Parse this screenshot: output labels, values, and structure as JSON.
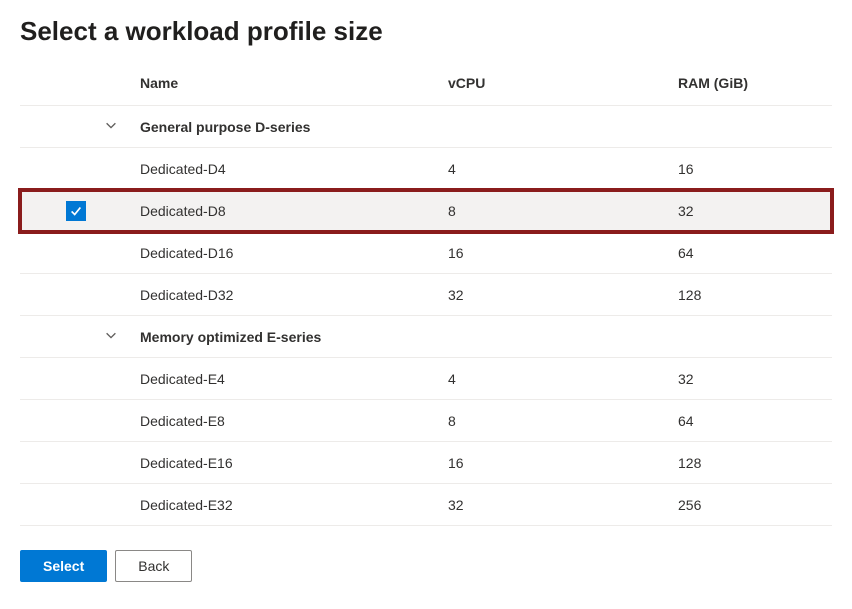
{
  "title": "Select a workload profile size",
  "columns": {
    "name": "Name",
    "vcpu": "vCPU",
    "ram": "RAM (GiB)"
  },
  "groups": [
    {
      "label": "General purpose D-series",
      "rows": [
        {
          "name": "Dedicated-D4",
          "vcpu": "4",
          "ram": "16",
          "selected": false
        },
        {
          "name": "Dedicated-D8",
          "vcpu": "8",
          "ram": "32",
          "selected": true
        },
        {
          "name": "Dedicated-D16",
          "vcpu": "16",
          "ram": "64",
          "selected": false
        },
        {
          "name": "Dedicated-D32",
          "vcpu": "32",
          "ram": "128",
          "selected": false
        }
      ]
    },
    {
      "label": "Memory optimized E-series",
      "rows": [
        {
          "name": "Dedicated-E4",
          "vcpu": "4",
          "ram": "32",
          "selected": false
        },
        {
          "name": "Dedicated-E8",
          "vcpu": "8",
          "ram": "64",
          "selected": false
        },
        {
          "name": "Dedicated-E16",
          "vcpu": "16",
          "ram": "128",
          "selected": false
        },
        {
          "name": "Dedicated-E32",
          "vcpu": "32",
          "ram": "256",
          "selected": false
        }
      ]
    }
  ],
  "buttons": {
    "select": "Select",
    "back": "Back"
  },
  "highlight_color": "#8a1c1c",
  "selected_row_path": "groups.0.rows.1"
}
